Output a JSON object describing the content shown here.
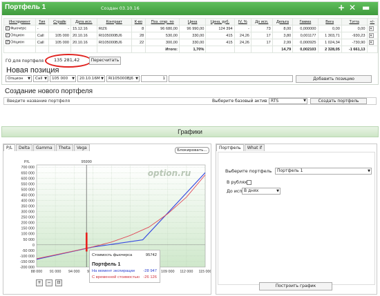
{
  "portfolio": {
    "title": "Портфель 1",
    "created": "Создан 03.10.16",
    "columns": [
      "Инструмент",
      "Тип",
      "Страйк",
      "Дата исп.",
      "Контракт",
      "К-во",
      "Поз. откр. по",
      "Цена",
      "Цена, руб.",
      "IV, %",
      "До исп.",
      "Дельта",
      "Гамма",
      "Вега",
      "Тэтта",
      "+/-"
    ],
    "rows": [
      [
        "Фьючерс",
        "-",
        "-",
        "15.12.16",
        "RIZ6",
        "8",
        "96 680,00",
        "96 990,00",
        "124 394",
        "-",
        "73",
        "8,00",
        "0,000000",
        "0,00",
        "0,00"
      ],
      [
        "Опцион",
        "Call",
        "105 000",
        "20.10.16",
        "RI105000BJ6",
        "28",
        "530,00",
        "330,00",
        "415",
        "24,26",
        "17",
        "3,80",
        "0,001177",
        "1 303,71",
        "-930,23"
      ],
      [
        "Опцион",
        "Call",
        "105 000",
        "20.10.16",
        "RI105000BJ6",
        "22",
        "300,00",
        "330,00",
        "415",
        "24,26",
        "17",
        "2,99",
        "0,000925",
        "1 024,34",
        "-730,90"
      ]
    ],
    "total_label": "Итого:",
    "total_percent": "1,70%",
    "totals": [
      "14,79",
      "0,002103",
      "2 328,05",
      "-1 661,13"
    ],
    "go_label": "ГО для портфеля",
    "go_value": "135 281,42",
    "recalc_button": "Пересчитать"
  },
  "new_position": {
    "heading": "Новая позиция",
    "fields": [
      "Опцион",
      "Call",
      "105 000",
      "20.10.16M",
      "RI105000BJ6",
      "1"
    ],
    "add_button": "Добавить позицию"
  },
  "create_portfolio": {
    "heading": "Создание нового портфеля",
    "name_placeholder": "Введите название портфеля",
    "base_asset_label": "Выберите базовый актив",
    "base_asset_value": "RTS",
    "create_button": "Создать портфель"
  },
  "charts": {
    "header": "Графики",
    "tabs": [
      "P/L",
      "Delta",
      "Gamma",
      "Theta",
      "Vega"
    ],
    "block_button": "Блокировать...",
    "watermark": "option.ru",
    "tooltip": {
      "futures_label": "Стоимость фьючерса",
      "futures_value": "95742",
      "portfolio": "Портфель 1",
      "expiry_label": "На момент экспирации",
      "expiry_value": "-28 947",
      "time_label": "С временной стоимостью",
      "time_value": "-26 126"
    }
  },
  "chart_data": {
    "type": "line",
    "ylabel": "P/L",
    "marker_x": "95990",
    "x_ticks": [
      "88 000",
      "91 000",
      "94 000",
      "97 000",
      "100 000",
      "103 000",
      "106 000",
      "109 000",
      "112 000",
      "115 000"
    ],
    "y_ticks": [
      "700 000",
      "650 000",
      "600 000",
      "550 000",
      "500 000",
      "450 000",
      "400 000",
      "350 000",
      "300 000",
      "250 000",
      "200 000",
      "150 000",
      "100 000",
      "50 000",
      "0",
      "-50 000",
      "-100 000",
      "-150 000",
      "-200 000"
    ],
    "xlim": [
      88000,
      115000
    ],
    "ylim": [
      -200000,
      720000
    ],
    "series": [
      {
        "name": "На момент экспирации",
        "color": "#3a4de0",
        "x": [
          88000,
          97000,
          105000,
          115000
        ],
        "y": [
          -130000,
          -20000,
          45000,
          650000
        ]
      },
      {
        "name": "С временной стоимостью",
        "color": "#e04a5a",
        "x": [
          88000,
          94000,
          97000,
          100000,
          103000,
          106000,
          109000,
          112000,
          115000
        ],
        "y": [
          -125000,
          -55000,
          -18000,
          25000,
          85000,
          160000,
          280000,
          430000,
          630000
        ]
      }
    ],
    "highlight_x": 96000,
    "highlight_color": "#e8201c"
  },
  "settings": {
    "tabs": [
      "Портфель",
      "What if"
    ],
    "portfolio_label": "Выберите портфель",
    "portfolio_value": "Портфель 1",
    "rubles_label": "В рублях:",
    "to_expiry_label": "До исп.:",
    "to_expiry_value": "В днях",
    "build_button": "Построить график"
  }
}
